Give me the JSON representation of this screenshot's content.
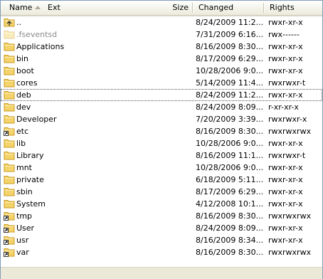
{
  "columns": {
    "name": "Name",
    "ext": "Ext",
    "size": "Size",
    "changed": "Changed",
    "rights": "Rights"
  },
  "colors": {
    "folder": "#f5d36b",
    "folder_dark": "#c79a21",
    "header_border": "#d6d2c2",
    "dim_text": "#8a8a8a"
  },
  "files": [
    {
      "name": "..",
      "changed": "8/24/2009 11:2...",
      "rights": "rwxr-xr-x",
      "icon": "parent-folder-icon"
    },
    {
      "name": ".fseventsd",
      "changed": "7/31/2009 6:16...",
      "rights": "rwx------",
      "icon": "hidden-folder-icon"
    },
    {
      "name": "Applications",
      "changed": "8/16/2009 8:30...",
      "rights": "rwxr-xr-x",
      "icon": "folder-icon"
    },
    {
      "name": "bin",
      "changed": "8/17/2009 6:29...",
      "rights": "rwxr-xr-x",
      "icon": "folder-icon"
    },
    {
      "name": "boot",
      "changed": "10/28/2006 9:0...",
      "rights": "rwxr-xr-x",
      "icon": "folder-icon"
    },
    {
      "name": "cores",
      "changed": "5/14/2009 11:4...",
      "rights": "rwxrwxr-t",
      "icon": "folder-icon"
    },
    {
      "name": "deb",
      "changed": "8/24/2009 11:2...",
      "rights": "rwxr-xr-x",
      "icon": "folder-icon"
    },
    {
      "name": "dev",
      "changed": "8/24/2009 8:09...",
      "rights": "r-xr-xr-x",
      "icon": "folder-icon"
    },
    {
      "name": "Developer",
      "changed": "7/20/2009 3:39...",
      "rights": "rwxrwxr-x",
      "icon": "folder-icon"
    },
    {
      "name": "etc",
      "changed": "8/16/2009 8:30...",
      "rights": "rwxrwxrwx",
      "icon": "folder-link-icon"
    },
    {
      "name": "lib",
      "changed": "10/28/2006 9:0...",
      "rights": "rwxr-xr-x",
      "icon": "folder-icon"
    },
    {
      "name": "Library",
      "changed": "8/16/2009 11:1...",
      "rights": "rwxrwxr-t",
      "icon": "folder-icon"
    },
    {
      "name": "mnt",
      "changed": "10/28/2006 9:0...",
      "rights": "rwxr-xr-x",
      "icon": "folder-icon"
    },
    {
      "name": "private",
      "changed": "6/18/2009 5:11...",
      "rights": "rwxr-xr-x",
      "icon": "folder-icon"
    },
    {
      "name": "sbin",
      "changed": "8/17/2009 6:29...",
      "rights": "rwxr-xr-x",
      "icon": "folder-icon"
    },
    {
      "name": "System",
      "changed": "4/12/2008 10:1...",
      "rights": "rwxr-xr-x",
      "icon": "folder-icon"
    },
    {
      "name": "tmp",
      "changed": "8/16/2009 8:30...",
      "rights": "rwxrwxrwx",
      "icon": "folder-link-icon"
    },
    {
      "name": "User",
      "changed": "8/24/2009 8:09...",
      "rights": "rwxr-xr-x",
      "icon": "folder-link-icon"
    },
    {
      "name": "usr",
      "changed": "8/16/2009 8:34...",
      "rights": "rwxr-xr-x",
      "icon": "folder-link-icon"
    },
    {
      "name": "var",
      "changed": "8/16/2009 8:30...",
      "rights": "rwxrwxrwx",
      "icon": "folder-link-icon"
    }
  ]
}
